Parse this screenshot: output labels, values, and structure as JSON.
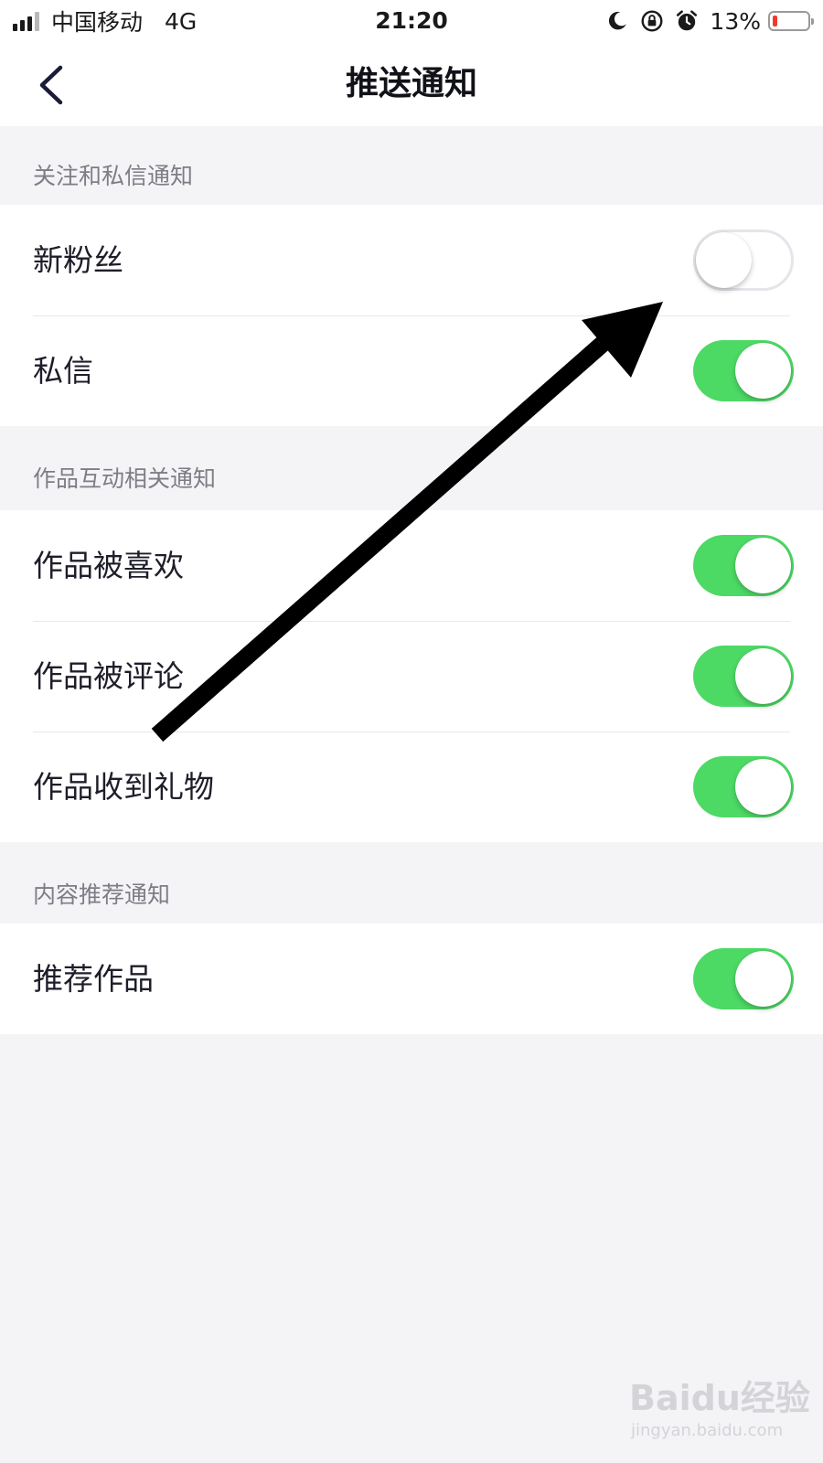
{
  "status_bar": {
    "carrier": "中国移动",
    "network": "4G",
    "time": "21:20",
    "battery_percent": "13%",
    "battery_level": 0.13,
    "signal_bars_active": 3,
    "icons": [
      "moon-icon",
      "rotation-lock-icon",
      "alarm-icon"
    ],
    "battery_color": "#f03a30"
  },
  "nav": {
    "back_icon": "chevron-left-icon",
    "title": "推送通知"
  },
  "sections": [
    {
      "header": "关注和私信通知",
      "items": [
        {
          "label": "新粉丝",
          "enabled": false
        },
        {
          "label": "私信",
          "enabled": true
        }
      ]
    },
    {
      "header": "作品互动相关通知",
      "items": [
        {
          "label": "作品被喜欢",
          "enabled": true
        },
        {
          "label": "作品被评论",
          "enabled": true
        },
        {
          "label": "作品收到礼物",
          "enabled": true
        }
      ]
    },
    {
      "header": "内容推荐通知",
      "items": [
        {
          "label": "推荐作品",
          "enabled": true
        }
      ]
    }
  ],
  "colors": {
    "toggle_on": "#4cd964",
    "background": "#f4f4f7",
    "annotation_arrow": "#000000"
  },
  "annotation": {
    "type": "arrow",
    "points_to": "新粉丝"
  },
  "watermark": {
    "logo": "Baidu经验",
    "site": "jingyan.baidu.com"
  }
}
